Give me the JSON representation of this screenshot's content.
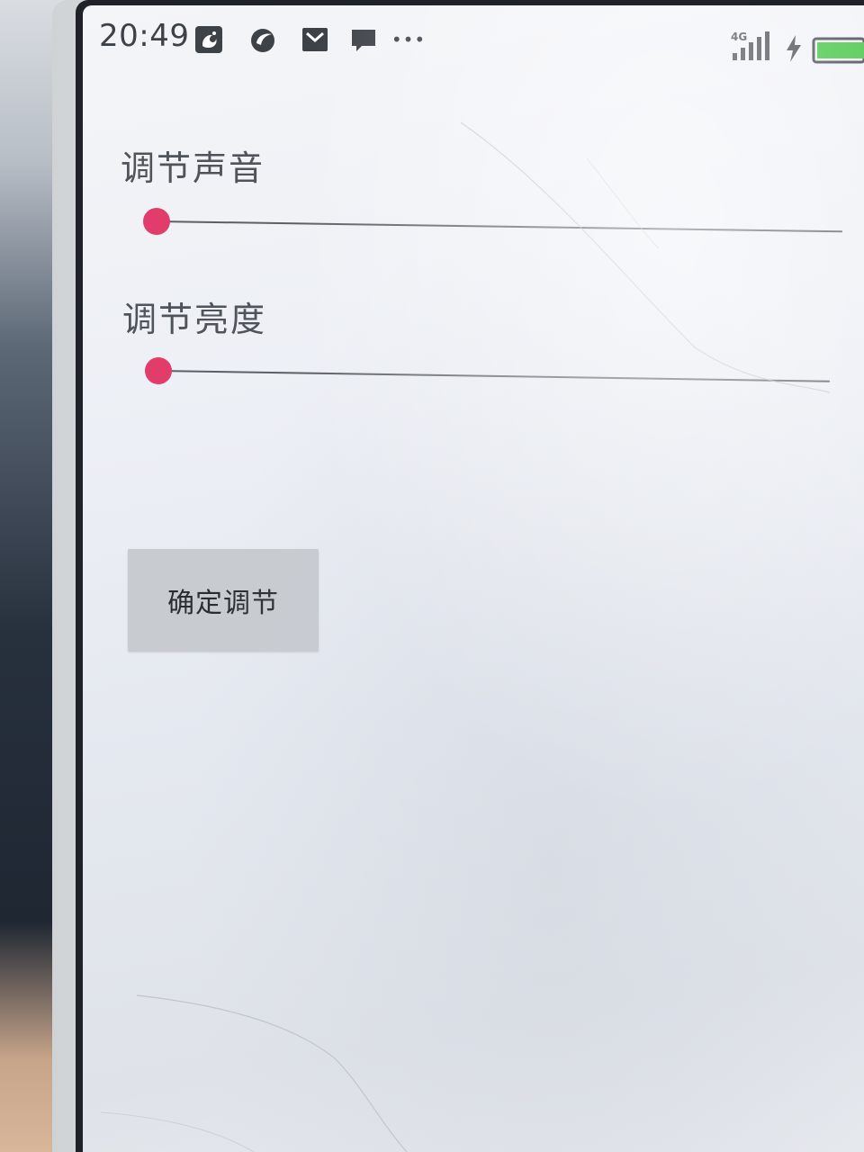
{
  "status_bar": {
    "time": "20:49",
    "network_label": "4G",
    "notification_icons": [
      "uc-browser-icon",
      "browser-icon",
      "mail-icon",
      "message-icon",
      "more-dots-icon"
    ],
    "more_dots": "•••"
  },
  "volume": {
    "label": "调节声音",
    "value_fraction": 0.0
  },
  "brightness": {
    "label": "调节亮度",
    "value_fraction": 0.0
  },
  "confirm_button": {
    "label": "确定调节"
  },
  "colors": {
    "slider_thumb": "#e23c6a",
    "battery": "#3bc43b"
  }
}
